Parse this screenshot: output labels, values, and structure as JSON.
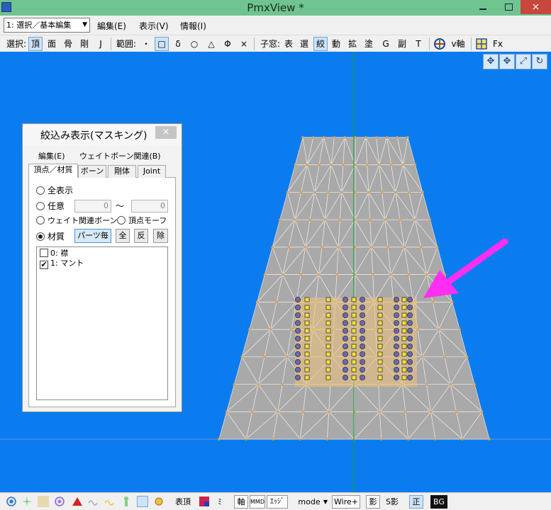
{
  "window": {
    "title": "PmxView *"
  },
  "menubar": {
    "mode_select": "1: 選択／基本編集",
    "items": [
      "編集(E)",
      "表示(V)",
      "情報(I)"
    ]
  },
  "toolbar": {
    "select_label": "選択:",
    "select_items": [
      "頂",
      "面",
      "骨",
      "剛",
      "J"
    ],
    "range_label": "範囲:",
    "range_items": [
      "・",
      "□",
      "δ",
      "○",
      "△",
      "Φ",
      "×"
    ],
    "subwindow_label": "子窓:",
    "subwindow_items": [
      "表",
      "選",
      "絞",
      "動",
      "拡",
      "塗",
      "G",
      "副",
      "T"
    ],
    "axis_label": "v軸",
    "fx_label": "Fx"
  },
  "nav_icons": [
    "move-xy-icon",
    "move-xz-icon",
    "zoom-icon",
    "rotate-icon"
  ],
  "panel": {
    "title": "絞込み表示(マスキング)",
    "close": "×",
    "menu": [
      "編集(E)",
      "ウェイトボーン関連(B)"
    ],
    "tabs": [
      "頂点／材質",
      "ボーン",
      "剛体",
      "Joint"
    ],
    "radio_all": "全表示",
    "radio_any": "任意",
    "range_from": "0",
    "range_tilde": "～",
    "range_to": "0",
    "radio_weight": "ウェイト関連ボーン",
    "radio_morph": "頂点モーフ",
    "radio_material": "材質",
    "btn_parts": "パーツ毎",
    "btn_all": "全",
    "btn_invert": "反",
    "btn_remove": "除",
    "materials": [
      {
        "label": "0: 襟",
        "checked": false
      },
      {
        "label": "1: マント",
        "checked": true
      }
    ]
  },
  "bottombar": {
    "vertex_label": "表頂",
    "mi_label": "ﾐ",
    "axis_label": "軸",
    "mmd_label": "MMD",
    "edge_label": "ｴｯｼﾞ",
    "mode_label": "mode",
    "wire_label": "Wire+",
    "shadow_label": "影",
    "sshadow_label": "S影",
    "ortho_label": "正",
    "bg_label": "BG"
  },
  "colors": {
    "viewport_bg": "#0a7cf0",
    "mesh_fill": "#a9a9a9",
    "wire": "#ffffff",
    "vertex": "#e8a040",
    "selected_vertex": "#f5e040",
    "arrow": "#ff2ef0",
    "axis_green": "#1f9b3a"
  }
}
